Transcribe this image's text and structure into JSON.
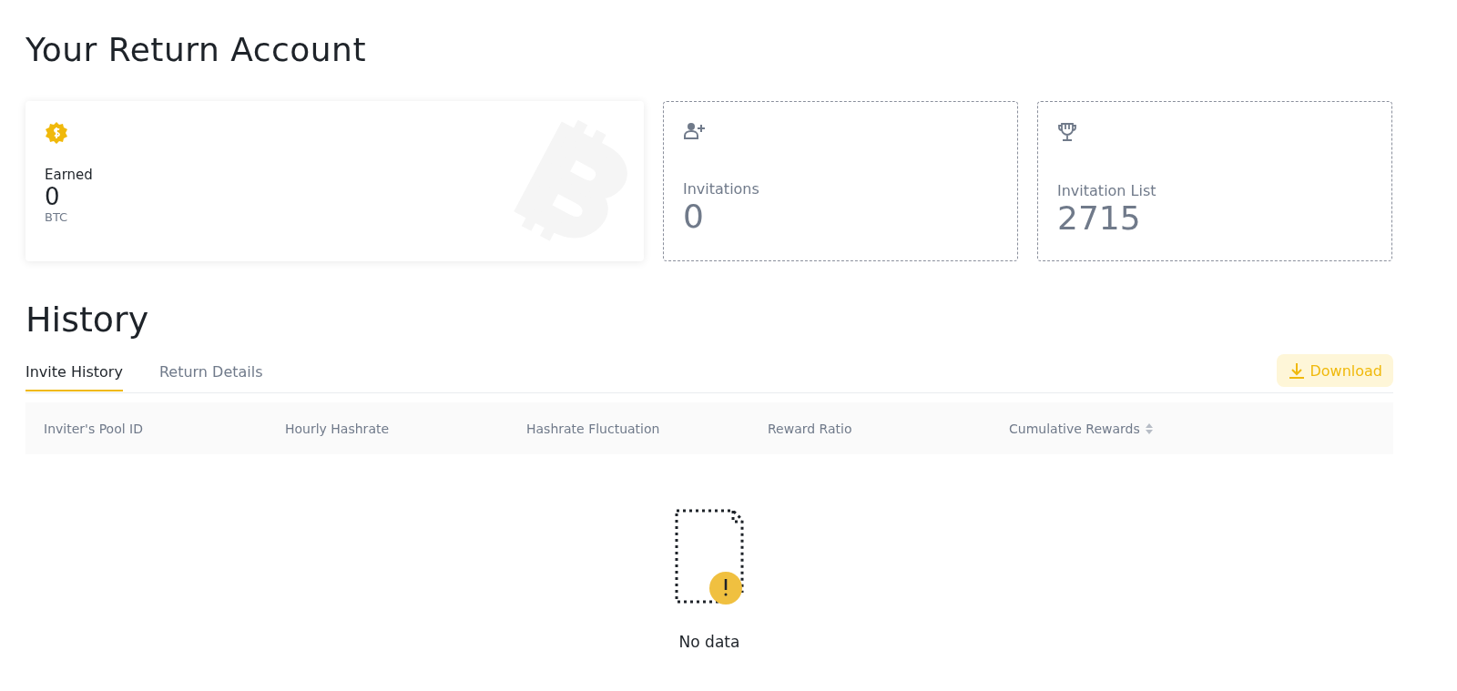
{
  "title": "Your Return Account",
  "stat_cards": [
    {
      "kind": "highlight",
      "label": "Earned",
      "value": "0",
      "unit": "BTC"
    },
    {
      "kind": "dashed",
      "label": "Invitations",
      "value": "0"
    },
    {
      "kind": "dashed",
      "label": "Invitation List",
      "value": "2715"
    }
  ],
  "history": {
    "title": "History",
    "tabs": [
      {
        "label": "Invite History",
        "selected": true
      },
      {
        "label": "Return Details",
        "selected": false
      }
    ],
    "download_button": "Download",
    "table": {
      "columns": [
        {
          "label": "Inviter's Pool ID",
          "sortable": false
        },
        {
          "label": "Hourly Hashrate",
          "sortable": false
        },
        {
          "label": "Hashrate Fluctuation",
          "sortable": false
        },
        {
          "label": "Reward Ratio",
          "sortable": false
        },
        {
          "label": "Cumulative Rewards",
          "sortable": true
        }
      ],
      "empty_text": "No data"
    }
  }
}
